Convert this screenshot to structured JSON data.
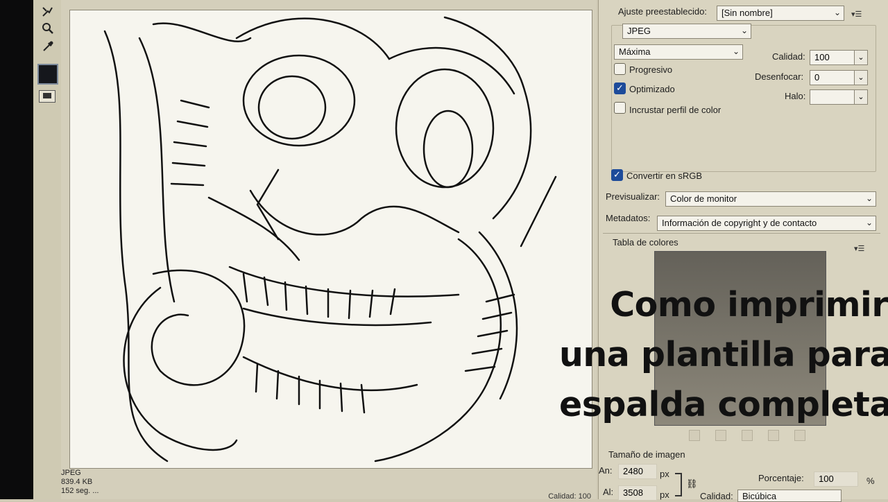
{
  "tools": [
    "slice-select-icon",
    "zoom-icon",
    "eyedropper-icon"
  ],
  "canvas": {
    "file_format": "JPEG",
    "file_size": "839.4 KB",
    "status_partial": "152 seg. ...",
    "right_status": "Calidad: 100"
  },
  "settings": {
    "preset_label": "Ajuste preestablecido:",
    "preset_value": "[Sin nombre]",
    "format_value": "JPEG",
    "quality_level": "Máxima",
    "quality_label": "Calidad:",
    "quality_value": "100",
    "blur_label": "Desenfocar:",
    "blur_value": "0",
    "halo_label": "Halo:",
    "halo_value": "",
    "progressive_label": "Progresivo",
    "progressive_checked": false,
    "optimized_label": "Optimizado",
    "optimized_checked": true,
    "embed_label": "Incrustar perfil de color",
    "embed_checked": false,
    "srgb_label": "Convertir en sRGB",
    "srgb_checked": true,
    "preview_label": "Previsualizar:",
    "preview_value": "Color de monitor",
    "metadata_label": "Metadatos:",
    "metadata_value": "Información de copyright y de contacto"
  },
  "color_table": {
    "title": "Tabla de colores"
  },
  "image_size": {
    "title": "Tamaño de imagen",
    "width_label": "An:",
    "width_value": "2480",
    "height_label": "Al:",
    "height_value": "3508",
    "unit": "px",
    "percent_label": "Porcentaje:",
    "percent_value": "100",
    "percent_unit": "%",
    "quality_label": "Calidad:",
    "quality_value": "Bicúbica"
  },
  "overlay": {
    "line1": "Como imprimir",
    "line2": "una plantilla para",
    "line3": "espalda completa"
  }
}
